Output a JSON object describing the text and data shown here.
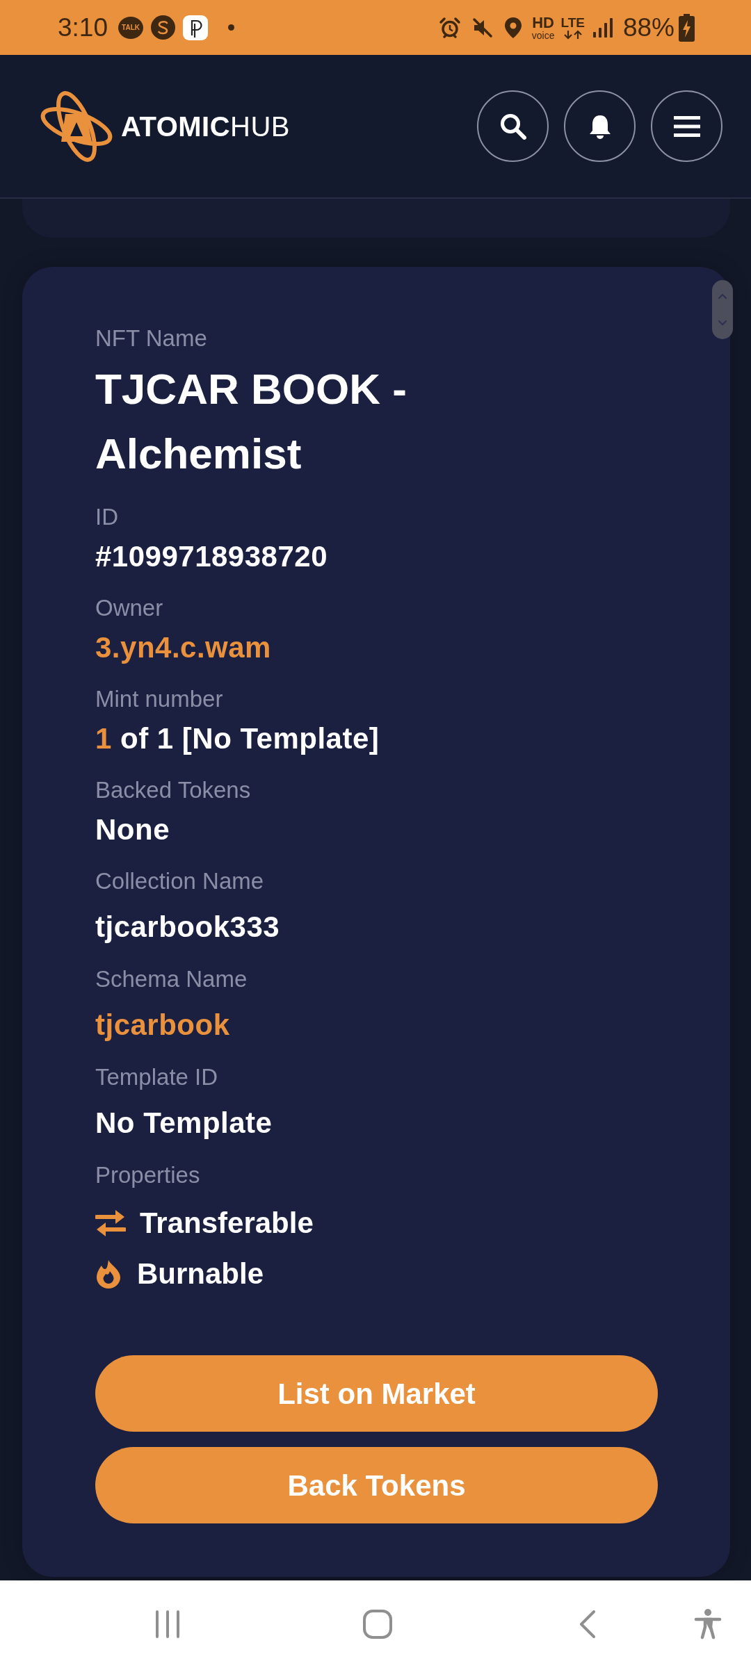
{
  "status_bar": {
    "time": "3:10",
    "notifications": [
      {
        "kind": "talk",
        "text": "TALK"
      },
      {
        "kind": "coin"
      },
      {
        "kind": "app"
      },
      {
        "kind": "more"
      }
    ],
    "indicators": [
      {
        "kind": "alarm"
      },
      {
        "kind": "mute"
      },
      {
        "kind": "location"
      },
      {
        "kind": "hd_voice",
        "text": "HD",
        "subtext": "voice"
      },
      {
        "kind": "lte",
        "text": "LTE"
      },
      {
        "kind": "signal"
      }
    ],
    "battery": "88%"
  },
  "header": {
    "logo_text": "**ATOMIC**HUB",
    "buttons": [
      {
        "kind": "search"
      },
      {
        "kind": "notifications"
      },
      {
        "kind": "menu"
      }
    ]
  },
  "fields": [
    {
      "label": "NFT Name",
      "kind": "title",
      "value": "TJCAR BOOK - Alchemist"
    },
    {
      "label": "ID",
      "kind": "text",
      "value": "#1099718938720"
    },
    {
      "label": "Owner",
      "kind": "link",
      "value": "3.yn4.c.wam"
    },
    {
      "label": "Mint number",
      "kind": "mint",
      "number": "1",
      "value": "of 1 [No Template]"
    },
    {
      "label": "Backed Tokens",
      "kind": "text",
      "value": "None"
    }
  ],
  "collection_fields": [
    {
      "label": "Collection Name",
      "kind": "text",
      "value": "tjcarbook333"
    },
    {
      "label": "Schema Name",
      "kind": "link",
      "value": "tjcarbook"
    },
    {
      "label": "Template ID",
      "kind": "text",
      "value": "No Template"
    }
  ],
  "properties": {
    "label": "Properties",
    "items": [
      {
        "kind": "transferable",
        "text": "Transferable"
      },
      {
        "kind": "burnable",
        "text": "Burnable"
      }
    ]
  },
  "buttons": [
    "List on Market",
    "Back Tokens"
  ],
  "nav_bar": [
    {
      "kind": "recents"
    },
    {
      "kind": "home"
    },
    {
      "kind": "back"
    },
    {
      "kind": "accessibility"
    }
  ]
}
